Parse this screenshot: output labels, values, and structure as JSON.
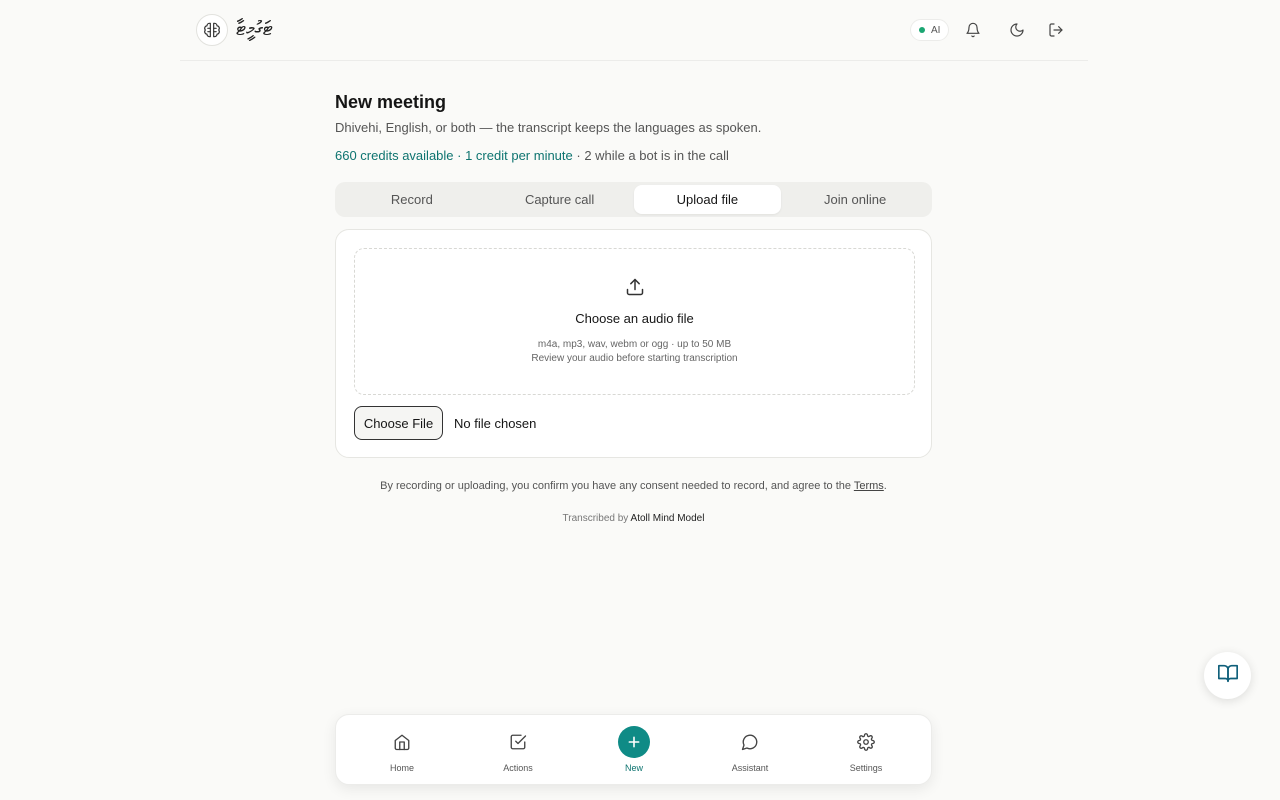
{
  "header": {
    "brand": "ޓަގުމީޓާ",
    "ai_label": "AI",
    "colors": {
      "status_dot": "#1aa672"
    }
  },
  "main": {
    "title": "New meeting",
    "subtitle": "Dhivehi, English, or both — the transcript keeps the languages as spoken.",
    "credits": {
      "available": "660 credits available",
      "rate": "1 credit per minute",
      "bot_rate": "2 while a bot is in the call",
      "separator": " · "
    },
    "tabs": [
      {
        "label": "Record"
      },
      {
        "label": "Capture call"
      },
      {
        "label": "Upload file",
        "active": true
      },
      {
        "label": "Join online"
      }
    ],
    "upload": {
      "title": "Choose an audio file",
      "formats": "m4a, mp3, wav, webm or ogg · up to 50 MB",
      "hint": "Review your audio before starting transcription",
      "choose_button": "Choose File",
      "no_file": "No file chosen"
    },
    "consent": {
      "text": "By recording or uploading, you confirm you have any consent needed to record, and agree to the",
      "terms_link": "Terms",
      "end": "."
    },
    "transcribed": {
      "prefix": "Transcribed by",
      "model": "Atoll Mind Model"
    }
  },
  "bottom_nav": [
    {
      "label": "Home",
      "icon": "home-icon"
    },
    {
      "label": "Actions",
      "icon": "checkbox-icon"
    },
    {
      "label": "New",
      "icon": "plus-icon",
      "active": true
    },
    {
      "label": "Assistant",
      "icon": "chat-bubble-icon"
    },
    {
      "label": "Settings",
      "icon": "gear-icon"
    }
  ],
  "colors": {
    "accent": "#0f8b86",
    "accent_text": "#0e7470",
    "background": "#fafaf8"
  }
}
